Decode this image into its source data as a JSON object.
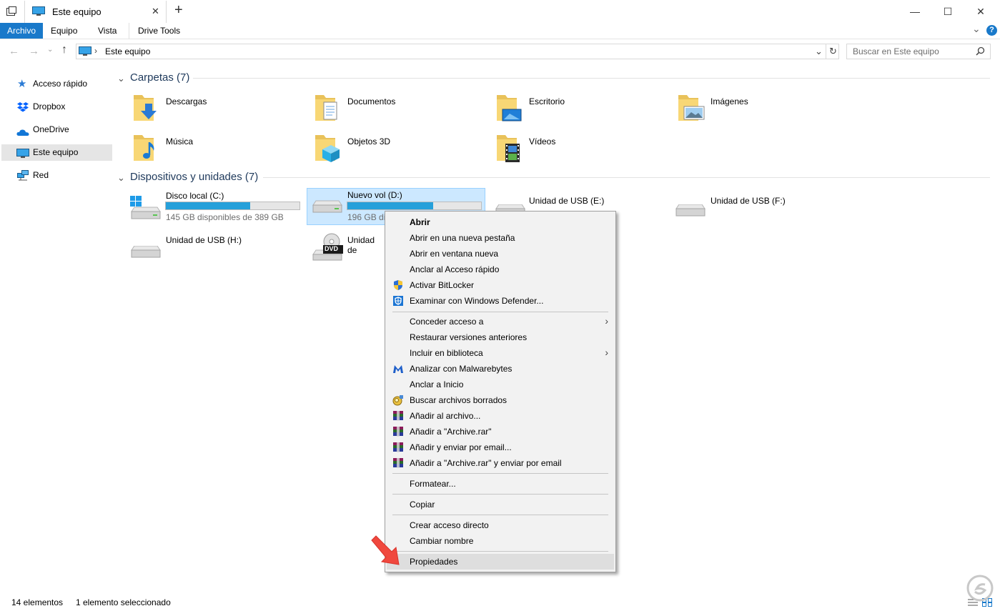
{
  "window": {
    "tab_title": "Este equipo",
    "new_tab": "+",
    "close_tab": "✕",
    "minimize": "—",
    "maximize": "☐",
    "close": "✕"
  },
  "ribbon": {
    "tabs": [
      "Archivo",
      "Equipo",
      "Vista",
      "Drive Tools"
    ],
    "collapse": "⌄",
    "help": "?"
  },
  "address": {
    "path": "Este equipo",
    "search_placeholder": "Buscar en Este equipo"
  },
  "nav": {
    "items": [
      "Acceso rápido",
      "Dropbox",
      "OneDrive",
      "Este equipo",
      "Red"
    ],
    "selected": "Este equipo"
  },
  "folders": {
    "header": "Carpetas (7)",
    "items": [
      "Descargas",
      "Documentos",
      "Escritorio",
      "Imágenes",
      "Música",
      "Objetos 3D",
      "Vídeos"
    ]
  },
  "devices": {
    "header": "Dispositivos y unidades (7)",
    "items": [
      {
        "name": "Disco local (C:)",
        "free": "145 GB disponibles de 389 GB",
        "used_fraction": 0.63
      },
      {
        "name": "Nuevo vol (D:)",
        "free": "196 GB dis",
        "used_fraction": 0.64
      },
      {
        "name": "Unidad de USB (E:)"
      },
      {
        "name": "Unidad de USB (F:)"
      },
      {
        "name": "Unidad de USB (H:)"
      },
      {
        "name": "Unidad de",
        "badge": "DVD"
      }
    ]
  },
  "context_menu": {
    "items": [
      "Abrir",
      "Abrir en una nueva pestaña",
      "Abrir en ventana nueva",
      "Anclar al Acceso rápido",
      "Activar BitLocker",
      "Examinar con Windows Defender...",
      "Conceder acceso a",
      "Restaurar versiones anteriores",
      "Incluir en biblioteca",
      "Analizar con Malwarebytes",
      "Anclar a Inicio",
      "Buscar archivos borrados",
      "Añadir al archivo...",
      "Añadir a \"Archive.rar\"",
      "Añadir y enviar por email...",
      "Añadir a \"Archive.rar\" y enviar por email",
      "Formatear...",
      "Copiar",
      "Crear acceso directo",
      "Cambiar nombre",
      "Propiedades"
    ],
    "submenu_arrow": "›"
  },
  "status": {
    "count": "14 elementos",
    "selected": "1 elemento seleccionado"
  },
  "colors": {
    "accent": "#1979ca",
    "bar_fill": "#26a0da",
    "selection": "#cce8ff",
    "arrow_annotation": "#f0483e"
  }
}
